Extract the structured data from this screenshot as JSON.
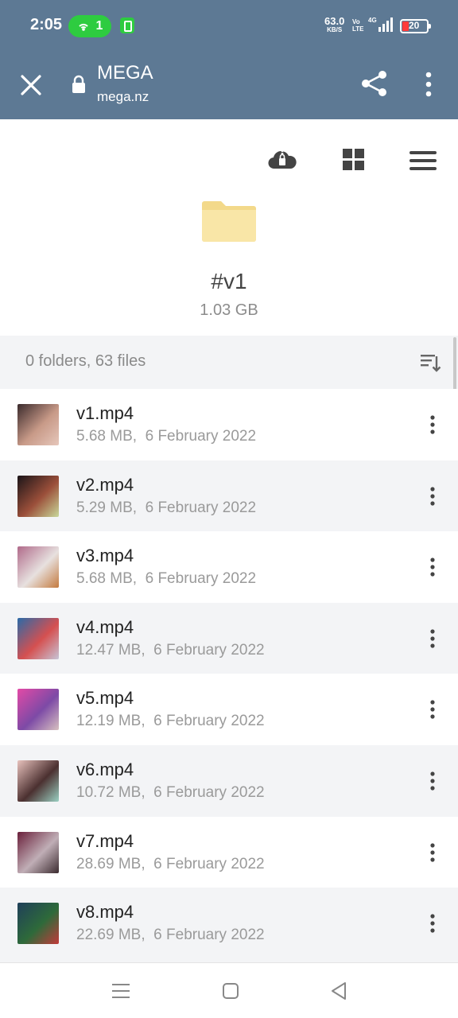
{
  "status_bar": {
    "time": "2:05",
    "hotspot_count": "1",
    "net_speed": "63.0",
    "net_speed_unit": "KB/S",
    "volte_top": "Vo",
    "volte_bottom": "LTE",
    "network": "4G",
    "battery": "20"
  },
  "browser": {
    "title": "MEGA",
    "url": "mega.nz",
    "close_icon": "close-icon",
    "lock_icon": "lock-icon",
    "share_icon": "share-icon",
    "more_icon": "more-vertical-icon"
  },
  "folder": {
    "name": "#v1",
    "size": "1.03 GB",
    "icon": "folder-icon",
    "color": "#f9e6a7"
  },
  "toolbar_icons": [
    "cloud-lock-icon",
    "grid-view-icon",
    "hamburger-menu-icon"
  ],
  "summary": {
    "text": "0 folders, 63 files",
    "sort_icon": "sort-icon"
  },
  "files": [
    {
      "name": "v1.mp4",
      "size": "5.68 MB,",
      "date": "6 February 2022",
      "thumb_colors": [
        "#3a2a2c",
        "#c89a88",
        "#e6c7bb"
      ]
    },
    {
      "name": "v2.mp4",
      "size": "5.29 MB,",
      "date": "6 February 2022",
      "thumb_colors": [
        "#1a1418",
        "#9b4f3a",
        "#c9d89a"
      ]
    },
    {
      "name": "v3.mp4",
      "size": "5.68 MB,",
      "date": "6 February 2022",
      "thumb_colors": [
        "#b06a8a",
        "#e7e1df",
        "#c47a3e"
      ]
    },
    {
      "name": "v4.mp4",
      "size": "12.47 MB,",
      "date": "6 February 2022",
      "thumb_colors": [
        "#2a6aa8",
        "#d55050",
        "#c7c4d6"
      ]
    },
    {
      "name": "v5.mp4",
      "size": "12.19 MB,",
      "date": "6 February 2022",
      "thumb_colors": [
        "#e34aa6",
        "#7d4aa6",
        "#d8c0c0"
      ]
    },
    {
      "name": "v6.mp4",
      "size": "10.72 MB,",
      "date": "6 February 2022",
      "thumb_colors": [
        "#e8c2bd",
        "#4b3030",
        "#9ad0c2"
      ]
    },
    {
      "name": "v7.mp4",
      "size": "28.69 MB,",
      "date": "6 February 2022",
      "thumb_colors": [
        "#6a1f3a",
        "#c0aeb6",
        "#3b2b2f"
      ]
    },
    {
      "name": "v8.mp4",
      "size": "22.69 MB,",
      "date": "6 February 2022",
      "thumb_colors": [
        "#1f3f5a",
        "#2e6a3a",
        "#c23a3a"
      ]
    }
  ],
  "nav": {
    "recents_icon": "recents-icon",
    "home_icon": "home-icon",
    "back_icon": "back-icon"
  }
}
